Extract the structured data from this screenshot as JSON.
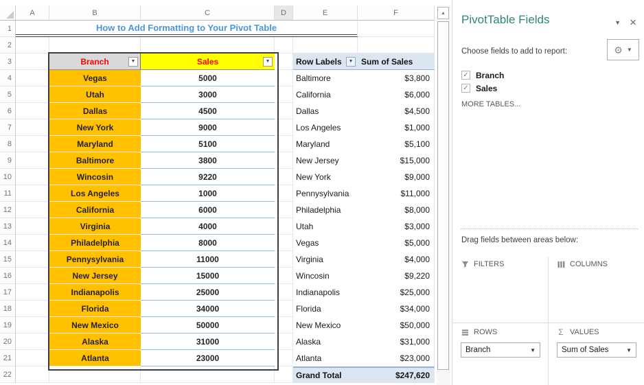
{
  "colors": {
    "title_blue": "#4E95D9",
    "header_red": "#FF0000",
    "header_gray": "#D9D9D9",
    "sales_yellow": "#FFFF00",
    "branch_orange": "#FFC000",
    "pivot_blue": "#DCE6F1",
    "pivot_border": "#95B3D7",
    "panel_teal": "#2E8676"
  },
  "icons": {
    "dropdown": "▼",
    "close": "×",
    "gear": "⚙",
    "check": "✓",
    "up_arrow": "▲",
    "sigma": "Σ"
  },
  "sheet": {
    "title": "How to Add Formatting to Your Pivot Table",
    "column_headers": [
      "A",
      "B",
      "C",
      "D",
      "E",
      "F"
    ],
    "row_count": 22,
    "data_table": {
      "headers": [
        "Branch",
        "Sales"
      ],
      "rows": [
        [
          "Vegas",
          "5000"
        ],
        [
          "Utah",
          "3000"
        ],
        [
          "Dallas",
          "4500"
        ],
        [
          "New York",
          "9000"
        ],
        [
          "Maryland",
          "5100"
        ],
        [
          "Baltimore",
          "3800"
        ],
        [
          "Wincosin",
          "9220"
        ],
        [
          "Los Angeles",
          "1000"
        ],
        [
          "California",
          "6000"
        ],
        [
          "Virginia",
          "4000"
        ],
        [
          "Philadelphia",
          "8000"
        ],
        [
          "Pennysylvania",
          "11000"
        ],
        [
          "New Jersey",
          "15000"
        ],
        [
          "Indianapolis",
          "25000"
        ],
        [
          "Florida",
          "34000"
        ],
        [
          "New Mexico",
          "50000"
        ],
        [
          "Alaska",
          "31000"
        ],
        [
          "Atlanta",
          "23000"
        ]
      ]
    },
    "pivot_table": {
      "headers": [
        "Row Labels",
        "Sum of Sales"
      ],
      "rows": [
        [
          "Baltimore",
          "$3,800"
        ],
        [
          "California",
          "$6,000"
        ],
        [
          "Dallas",
          "$4,500"
        ],
        [
          "Los Angeles",
          "$1,000"
        ],
        [
          "Maryland",
          "$5,100"
        ],
        [
          "New Jersey",
          "$15,000"
        ],
        [
          "New York",
          "$9,000"
        ],
        [
          "Pennysylvania",
          "$11,000"
        ],
        [
          "Philadelphia",
          "$8,000"
        ],
        [
          "Utah",
          "$3,000"
        ],
        [
          "Vegas",
          "$5,000"
        ],
        [
          "Virginia",
          "$4,000"
        ],
        [
          "Wincosin",
          "$9,220"
        ],
        [
          "Indianapolis",
          "$25,000"
        ],
        [
          "Florida",
          "$34,000"
        ],
        [
          "New Mexico",
          "$50,000"
        ],
        [
          "Alaska",
          "$31,000"
        ],
        [
          "Atlanta",
          "$23,000"
        ]
      ],
      "grand_total": [
        "Grand Total",
        "$247,620"
      ]
    }
  },
  "panel": {
    "title": "PivotTable Fields",
    "choose_fields_label": "Choose fields to add to report:",
    "fields": [
      {
        "label": "Branch",
        "checked": true
      },
      {
        "label": "Sales",
        "checked": true
      }
    ],
    "more_tables_label": "MORE TABLES...",
    "drag_fields_label": "Drag fields between areas below:",
    "areas": {
      "filters_label": "FILTERS",
      "columns_label": "COLUMNS",
      "rows_label": "ROWS",
      "values_label": "VALUES",
      "rows_field": "Branch",
      "values_field": "Sum of Sales"
    }
  }
}
